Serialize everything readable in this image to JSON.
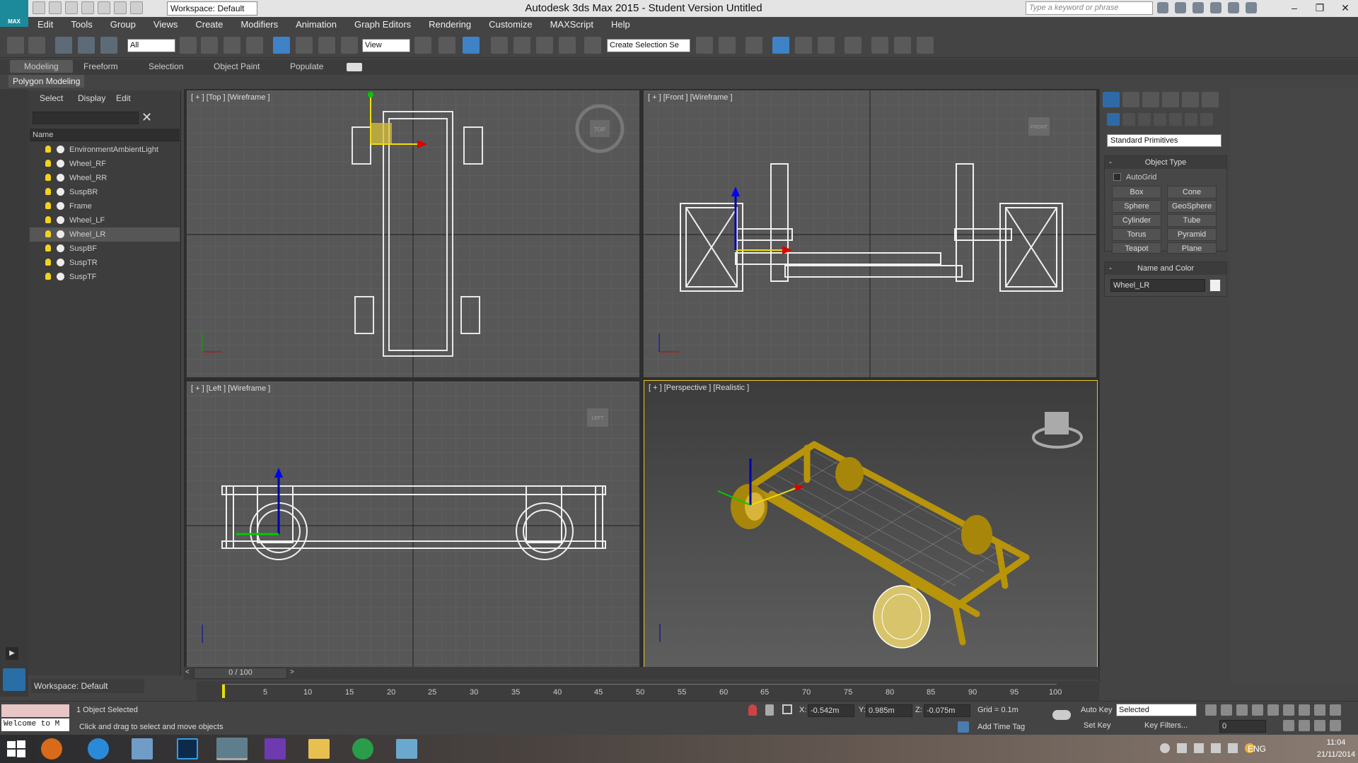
{
  "titlebar": {
    "workspace_select": "Workspace: Default",
    "title": "Autodesk 3ds Max  2015   - Student Version    Untitled",
    "search_placeholder": "Type a keyword or phrase",
    "logo_text": "MAX"
  },
  "menus": [
    "Edit",
    "Tools",
    "Group",
    "Views",
    "Create",
    "Modifiers",
    "Animation",
    "Graph Editors",
    "Rendering",
    "Customize",
    "MAXScript",
    "Help"
  ],
  "toolbar": {
    "filter_select": "All",
    "refcoord_select": "View",
    "named_selection": "Create Selection Se"
  },
  "ribbon": {
    "tabs": [
      "Modeling",
      "Freeform",
      "Selection",
      "Object Paint",
      "Populate"
    ],
    "active_panel": "Polygon Modeling"
  },
  "scene_explorer": {
    "menu": [
      "Select",
      "Display",
      "Edit"
    ],
    "column_header": "Name",
    "rows": [
      "EnvironmentAmbientLight",
      "Wheel_RF",
      "Wheel_RR",
      "SuspBR",
      "Frame",
      "Wheel_LF",
      "Wheel_LR",
      "SuspBF",
      "SuspTR",
      "SuspTF"
    ],
    "selected_row": "Wheel_LR"
  },
  "viewports": {
    "top": {
      "label": "[ + ] [Top ] [Wireframe ]",
      "cube": "TOP"
    },
    "front": {
      "label": "[ + ] [Front ] [Wireframe ]",
      "cube": "FRONT"
    },
    "left": {
      "label": "[ + ] [Left ] [Wireframe ]",
      "cube": "LEFT"
    },
    "perspective": {
      "label": "[ + ] [Perspective ] [Realistic ]"
    }
  },
  "command_panel": {
    "primitive_select": "Standard Primitives",
    "object_type": {
      "title": "Object Type",
      "autogrid": "AutoGrid",
      "buttons": [
        "Box",
        "Cone",
        "Sphere",
        "GeoSphere",
        "Cylinder",
        "Tube",
        "Torus",
        "Pyramid",
        "Teapot",
        "Plane"
      ]
    },
    "name_color": {
      "title": "Name and Color",
      "name": "Wheel_LR"
    }
  },
  "timeline": {
    "frame_display": "0 / 100",
    "ticks": [
      "5",
      "10",
      "15",
      "20",
      "25",
      "30",
      "35",
      "40",
      "45",
      "50",
      "55",
      "60",
      "65",
      "70",
      "75",
      "80",
      "85",
      "90",
      "95",
      "100"
    ]
  },
  "status": {
    "workspace": "Workspace: Default",
    "maxscript_listener": "Welcome to M",
    "selection_count": "1 Object Selected",
    "prompt": "Click and drag to select and move objects",
    "x_label": "X:",
    "x_value": "-0.542m",
    "y_label": "Y:",
    "y_value": "0.985m",
    "z_label": "Z:",
    "z_value": "-0.075m",
    "grid": "Grid = 0.1m",
    "add_time_tag": "Add Time Tag",
    "auto_key": "Auto Key",
    "set_key": "Set Key",
    "key_mode_select": "Selected",
    "key_filters": "Key Filters...",
    "current_frame": "0"
  },
  "taskbar": {
    "lang": "ENG",
    "time": "11:04",
    "date": "21/11/2014"
  },
  "colors": {
    "accent_blue": "#1c8a9a",
    "selection_yellow": "#f0c81c",
    "model_gold": "#b8940a"
  }
}
